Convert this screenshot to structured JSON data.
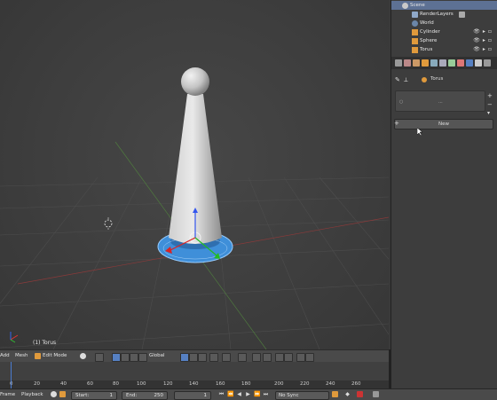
{
  "viewport": {
    "object_label": "(1) Torus"
  },
  "outliner": {
    "rows": [
      {
        "label": "Scene",
        "icon": "scene-icon",
        "selected": true
      },
      {
        "label": "RenderLayers",
        "icon": "renderlayers-icon",
        "selected": false
      },
      {
        "label": "World",
        "icon": "world-icon",
        "selected": false
      },
      {
        "label": "Cylinder",
        "icon": "cylinder-object-icon",
        "selected": false
      },
      {
        "label": "Sphere",
        "icon": "sphere-object-icon",
        "selected": false
      },
      {
        "label": "Torus",
        "icon": "torus-object-icon",
        "selected": false
      }
    ]
  },
  "properties": {
    "object_name": "Torus",
    "list_value": "...",
    "new_button": "New"
  },
  "header_bar": {
    "add_label": "Add",
    "mesh_label": "Mesh",
    "mode_label": "Edit Mode",
    "orientation_label": "Global"
  },
  "timeline": {
    "ticks": [
      "0",
      "20",
      "40",
      "60",
      "80",
      "100",
      "120",
      "140",
      "160",
      "180",
      "200",
      "220",
      "240",
      "260"
    ]
  },
  "bottom_bar": {
    "frame_label": "Frame",
    "playback_label": "Playback",
    "start_label": "Start:",
    "start_value": "1",
    "end_label": "End:",
    "end_value": "250",
    "current_frame": "1",
    "sync_label": "No Sync"
  },
  "colors": {
    "selection": "#5d7194",
    "accent_blue": "#5680c2",
    "torus_blue": "#4aa0e6",
    "axis_red": "#cc3333",
    "axis_green": "#3bb33b"
  }
}
